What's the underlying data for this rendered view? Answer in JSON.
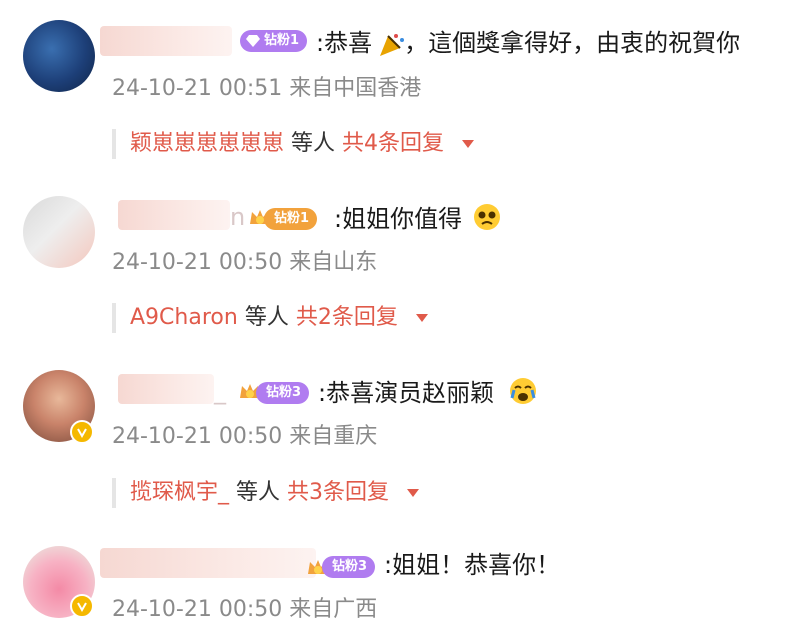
{
  "comments": [
    {
      "badge": "钻粉1",
      "text": ":恭喜",
      "text_after_icon": "，這個獎拿得好，由衷的祝賀你",
      "meta": "24-10-21 00:51 来自中国香港",
      "reply": {
        "name": "颖崽崽崽崽崽崽",
        "mid": "等人",
        "count": "共4条回复"
      }
    },
    {
      "name_tail": "n",
      "badge": "钻粉1",
      "text": ":姐姐你值得",
      "meta": "24-10-21 00:50 来自山东",
      "reply": {
        "name": "A9Charon",
        "mid": "等人",
        "count": "共2条回复"
      }
    },
    {
      "name_tail": "_",
      "badge": "钻粉3",
      "text": ":恭喜演员赵丽颖",
      "meta": "24-10-21 00:50 来自重庆",
      "reply": {
        "name": "揽琛枫宇_",
        "mid": "等人",
        "count": "共3条回复"
      }
    },
    {
      "badge": "钻粉3",
      "text": ":姐姐！恭喜你！",
      "meta": "24-10-21 00:50 来自广西"
    }
  ],
  "colors": {
    "reply_accent": "#e05a4a",
    "meta_gray": "#8a8a8a",
    "badge_purple": "#b07cf0",
    "badge_orange": "#f2a23c",
    "verified_gold": "#f5b800"
  },
  "icons": [
    "gem-icon",
    "crown-icon",
    "party-popper-icon",
    "pleading-face-icon",
    "crying-face-icon",
    "verified-icon",
    "caret-down-icon"
  ]
}
